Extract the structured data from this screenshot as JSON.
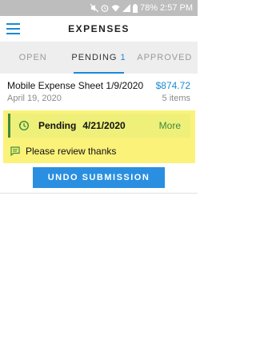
{
  "status_bar": {
    "battery": "78%",
    "time": "2:57 PM",
    "icons": [
      "mute-icon",
      "alarm-icon",
      "wifi-icon",
      "signal-icon",
      "battery-icon"
    ]
  },
  "header": {
    "title": "EXPENSES",
    "menu_icon": "hamburger-menu-icon"
  },
  "tabs": [
    {
      "label": "OPEN",
      "count": ""
    },
    {
      "label": "PENDING",
      "count": "1"
    },
    {
      "label": "APPROVED",
      "count": ""
    }
  ],
  "expense": {
    "title": "Mobile Expense Sheet 1/9/2020",
    "amount": "$874.72",
    "date": "April 19, 2020",
    "items": "5 items",
    "status": {
      "label": "Pending",
      "date": "4/21/2020",
      "more": "More",
      "icon": "history-clock-icon"
    },
    "comment": {
      "text": "Please review thanks",
      "icon": "comment-icon"
    },
    "undo_label": "UNDO SUBMISSION"
  },
  "colors": {
    "accent": "#1a8ad4",
    "button": "#2a8fe0",
    "pending_green": "#3e8a3e",
    "highlight": "#fbf27a"
  }
}
